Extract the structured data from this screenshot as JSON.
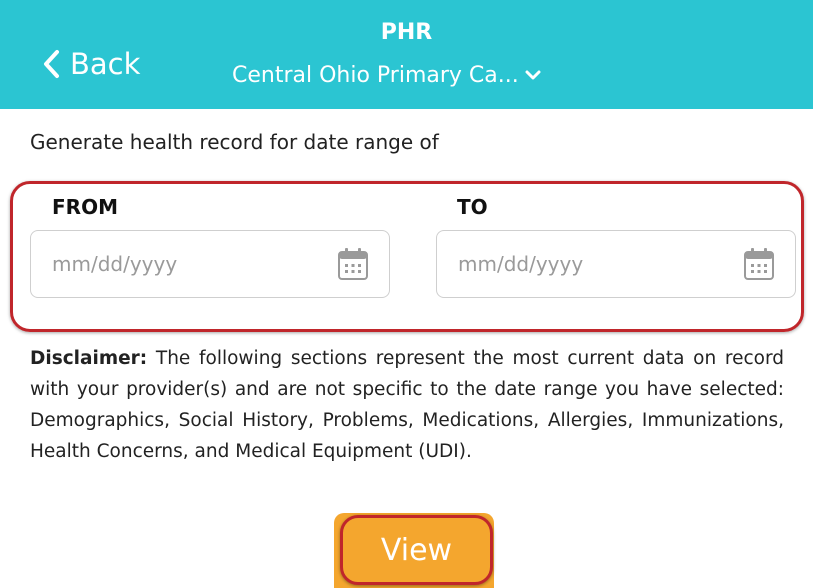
{
  "header": {
    "back_label": "Back",
    "title": "PHR",
    "organization": "Central Ohio Primary Ca..."
  },
  "intro": "Generate health record for date range of",
  "range": {
    "from_label": "FROM",
    "to_label": "TO",
    "from_placeholder": "mm/dd/yyyy",
    "to_placeholder": "mm/dd/yyyy"
  },
  "disclaimer": {
    "prefix": "Disclaimer:",
    "text": " The following sections represent the most current data on record with your provider(s) and are not specific to the date range you have selected: Demographics, Social History, Problems, Medications, Allergies, Immunizations, Health Concerns, and Medical Equipment (UDI)."
  },
  "view_label": "View",
  "colors": {
    "header": "#2bc5d2",
    "highlight": "#c0262b",
    "button": "#f4a62e"
  },
  "icons": {
    "back": "chevron-left-icon",
    "org": "chevron-down-icon",
    "date": "calendar-icon"
  }
}
